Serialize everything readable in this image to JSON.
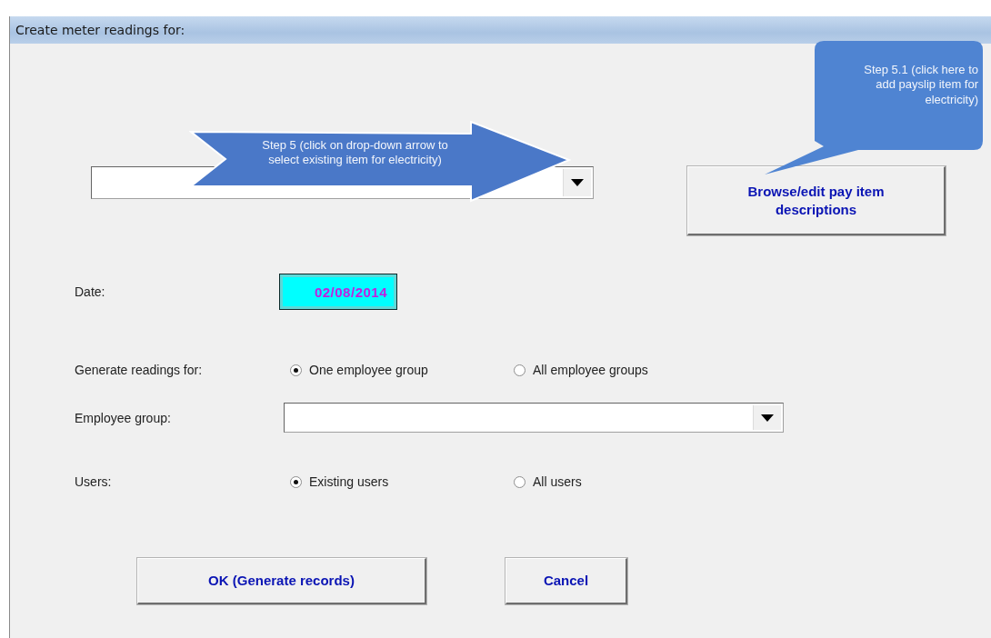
{
  "window": {
    "title": "Create meter readings for:"
  },
  "pay_item_combo": {
    "expanded": false
  },
  "browse_button": {
    "label": "Browse/edit pay item descriptions"
  },
  "date": {
    "label": "Date:",
    "value": "02/08/2014"
  },
  "generate_for": {
    "label": "Generate readings for:",
    "options": [
      {
        "label": "One employee group",
        "selected": true
      },
      {
        "label": "All employee groups",
        "selected": false
      }
    ]
  },
  "employee_group": {
    "label": "Employee group:"
  },
  "users": {
    "label": "Users:",
    "options": [
      {
        "label": "Existing users",
        "selected": true
      },
      {
        "label": "All users",
        "selected": false
      }
    ]
  },
  "buttons": [
    {
      "label": "OK (Generate records)",
      "kind": "wide"
    },
    {
      "label": "Cancel",
      "kind": "narrow"
    }
  ],
  "callouts": [
    {
      "kind": "arrow",
      "text": "Step 5 (click on drop-down arrow to select existing item for electricity)"
    },
    {
      "kind": "bubble",
      "text": "Step 5.1 (click here to add payslip item for electricity)"
    }
  ]
}
